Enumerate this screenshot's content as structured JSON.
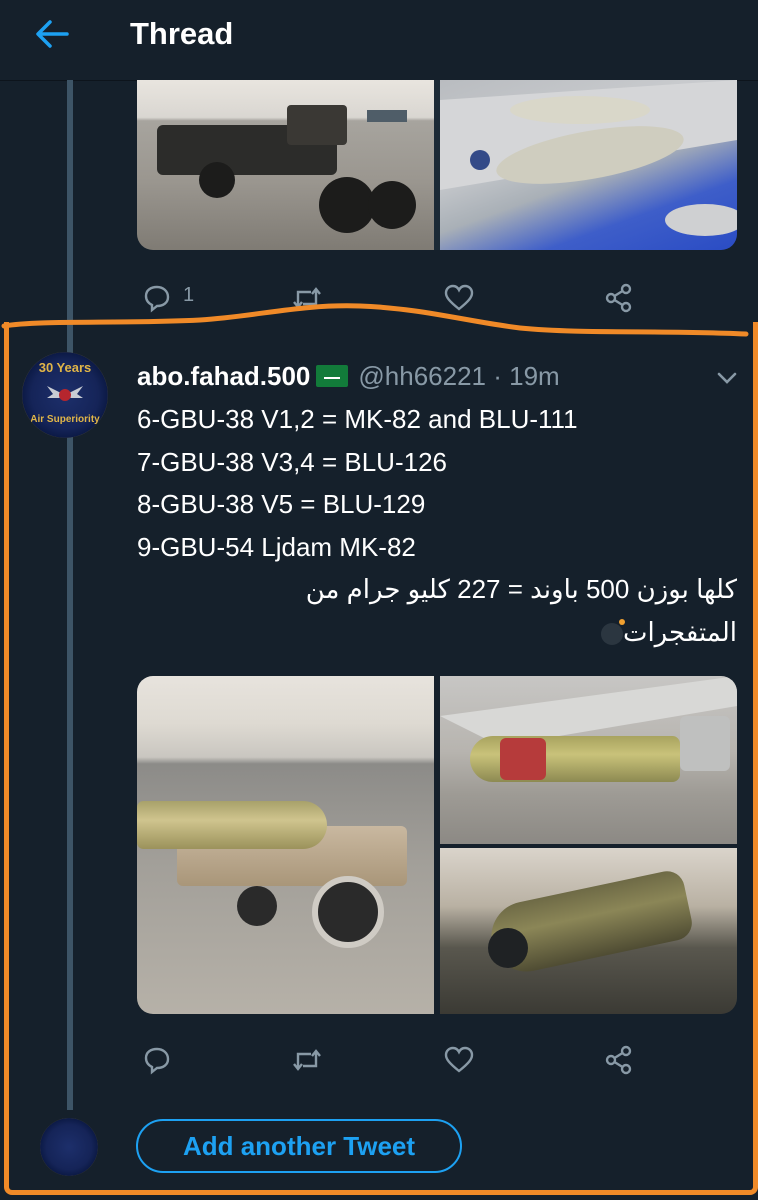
{
  "header": {
    "title": "Thread"
  },
  "prev_tweet": {
    "reply_count": "1"
  },
  "tweet": {
    "display_name": "abo.fahad.500",
    "handle_time": "@hh66221 · 19m",
    "lines": [
      "6-GBU-38 V1,2 = MK-82 and BLU-111",
      "7-GBU-38 V3,4 = BLU-126",
      "8-GBU-38 V5 = BLU-129",
      "9-GBU-54 Ljdam MK-82"
    ],
    "arabic_line1": "كلها بوزن 500 باوند = 227 كليو جرام من",
    "arabic_line2": "المتفجرات"
  },
  "avatar": {
    "top_text": "30 Years",
    "bottom_text": "Air Superiority"
  },
  "composer": {
    "add_label": "Add another Tweet"
  },
  "colors": {
    "background": "#15202b",
    "accent": "#1da1f2",
    "muted": "#8899a6",
    "highlight": "#f08a28"
  },
  "icons": [
    "back-arrow-icon",
    "reply-icon",
    "retweet-icon",
    "like-icon",
    "share-icon",
    "chevron-down-icon"
  ]
}
